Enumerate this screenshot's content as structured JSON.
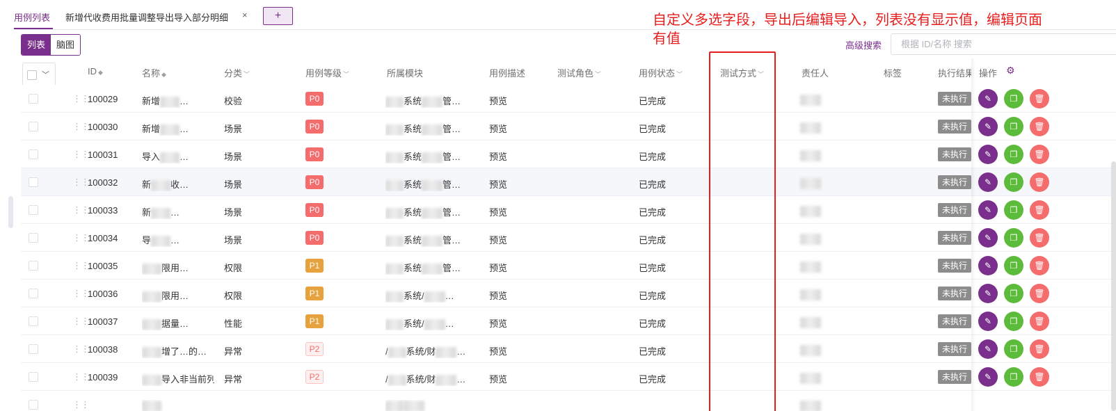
{
  "tabs": [
    {
      "label": "用例列表",
      "active": true
    },
    {
      "label": "新增代收费用批量调整导出导入部分明细",
      "closable": true
    }
  ],
  "tab_add_label": "+",
  "tab_close_label": "×",
  "view_toggle": [
    {
      "label": "列表",
      "active": true
    },
    {
      "label": "脑图",
      "active": false
    }
  ],
  "annotation_text": "自定义多选字段，导出后编辑导入，列表没有显示值，编辑页面有值",
  "advanced_search_label": "高级搜索",
  "search": {
    "placeholder": "根据 ID/名称 搜索",
    "value": ""
  },
  "columns": {
    "id": "ID",
    "name": "名称",
    "category": "分类",
    "level": "用例等级",
    "module": "所属模块",
    "desc": "用例描述",
    "role": "测试角色",
    "status": "用例状态",
    "method": "测试方式",
    "owner": "责任人",
    "tags": "标签",
    "exec": "执行结果",
    "ops": "操作"
  },
  "rows": [
    {
      "id": "100029",
      "name_a": "新增",
      "name_b": "…",
      "category": "校验",
      "level": "P0",
      "module_a": "",
      "module_b": "系统",
      "module_c": "管…",
      "desc": "预览",
      "status": "已完成",
      "exec": "未执行"
    },
    {
      "id": "100030",
      "name_a": "新增",
      "name_b": "…",
      "category": "场景",
      "level": "P0",
      "module_a": "",
      "module_b": "系统",
      "module_c": "管…",
      "desc": "预览",
      "status": "已完成",
      "exec": "未执行"
    },
    {
      "id": "100031",
      "name_a": "导入",
      "name_b": "…",
      "category": "场景",
      "level": "P0",
      "module_a": "",
      "module_b": "系统",
      "module_c": "管…",
      "desc": "预览",
      "status": "已完成",
      "exec": "未执行"
    },
    {
      "id": "100032",
      "name_a": "新",
      "name_b": "收…",
      "category": "场景",
      "level": "P0",
      "module_a": "",
      "module_b": "系统",
      "module_c": "管…",
      "desc": "预览",
      "status": "已完成",
      "exec": "未执行"
    },
    {
      "id": "100033",
      "name_a": "新",
      "name_b": "…",
      "category": "场景",
      "level": "P0",
      "module_a": "",
      "module_b": "系统",
      "module_c": "管…",
      "desc": "预览",
      "status": "已完成",
      "exec": "未执行"
    },
    {
      "id": "100034",
      "name_a": "导",
      "name_b": "…",
      "category": "场景",
      "level": "P0",
      "module_a": "",
      "module_b": "系统",
      "module_c": "管…",
      "desc": "预览",
      "status": "已完成",
      "exec": "未执行"
    },
    {
      "id": "100035",
      "name_a": "",
      "name_b": "限用…",
      "category": "权限",
      "level": "P1",
      "module_a": "",
      "module_b": "系统",
      "module_c": "管…",
      "desc": "预览",
      "status": "已完成",
      "exec": "未执行"
    },
    {
      "id": "100036",
      "name_a": "",
      "name_b": "限用…",
      "category": "权限",
      "level": "P1",
      "module_a": "",
      "module_b": "系统/",
      "module_c": "…",
      "desc": "预览",
      "status": "已完成",
      "exec": "未执行"
    },
    {
      "id": "100037",
      "name_a": "",
      "name_b": "据量…",
      "category": "性能",
      "level": "P1",
      "module_a": "",
      "module_b": "系统/",
      "module_c": "…",
      "desc": "预览",
      "status": "已完成",
      "exec": "未执行"
    },
    {
      "id": "100038",
      "name_a": "",
      "name_b": "增了…的…",
      "category": "异常",
      "level": "P2",
      "module_a": "/",
      "module_b": "系统/财",
      "module_c": "…",
      "desc": "预览",
      "status": "已完成",
      "exec": "未执行"
    },
    {
      "id": "100039",
      "name_a": "",
      "name_b": "导入非当前列…",
      "category": "异常",
      "level": "P2",
      "module_a": "/",
      "module_b": "系统/财",
      "module_c": "…",
      "desc": "预览",
      "status": "已完成",
      "exec": "未执行"
    },
    {
      "id": "",
      "name_a": "",
      "name_b": "",
      "category": "",
      "level": "",
      "module_a": "",
      "module_b": "",
      "module_c": "",
      "desc": "",
      "status": "",
      "exec": ""
    }
  ],
  "icons": {
    "edit": "pencil-icon",
    "copy": "copy-icon",
    "delete": "trash-icon",
    "settings": "gear-icon",
    "drag": "drag-handle-icon",
    "sort": "sort-icon",
    "filter": "chevron-down-icon"
  },
  "colors": {
    "brand": "#7b2f8c",
    "p0": "#f56c6c",
    "p1": "#e6a23c",
    "edit_btn": "#7b2f8c",
    "copy_btn": "#5dbb3b",
    "delete_btn": "#f56c6c",
    "annotation": "#e81e1e"
  }
}
